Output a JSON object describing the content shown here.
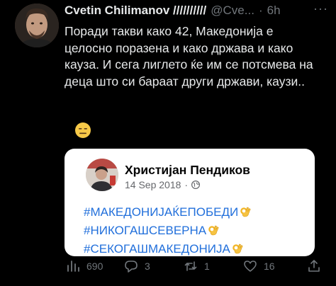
{
  "tweet": {
    "author_name": "Cvetin Chilimanov //////////",
    "handle": "@Cve...",
    "separator": "·",
    "time": "6h",
    "more": "···",
    "text": "Поради такви како 42, Македонија е целосно поразена и како држава и како кауза. И сега лиглето ќе им се потсмева на деца што си бараат други држави, каузи..",
    "avatar_icon": "user-avatar"
  },
  "embedded_card": {
    "reaction_emoji": "neutral-face-emoji",
    "author": "Христијан Пендиков",
    "date": "14 Sep 2018",
    "date_separator": "·",
    "privacy_icon": "globe-icon",
    "hashtags": [
      "#МАКЕДОНИЈАЌЕПОБЕДИ",
      "#НИКОГАШСЕВЕРНА",
      "#СЕКОГАШМАКЕДОНИЈА"
    ],
    "hashtag_emoji": "ok-hand-emoji",
    "colors": {
      "link": "#216fdb",
      "background": "#ffffff"
    }
  },
  "actions": {
    "views": "690",
    "replies": "3",
    "retweets": "1",
    "likes": "16"
  },
  "colors": {
    "background": "#000000",
    "text": "#e7e9ea",
    "muted": "#71767b"
  }
}
